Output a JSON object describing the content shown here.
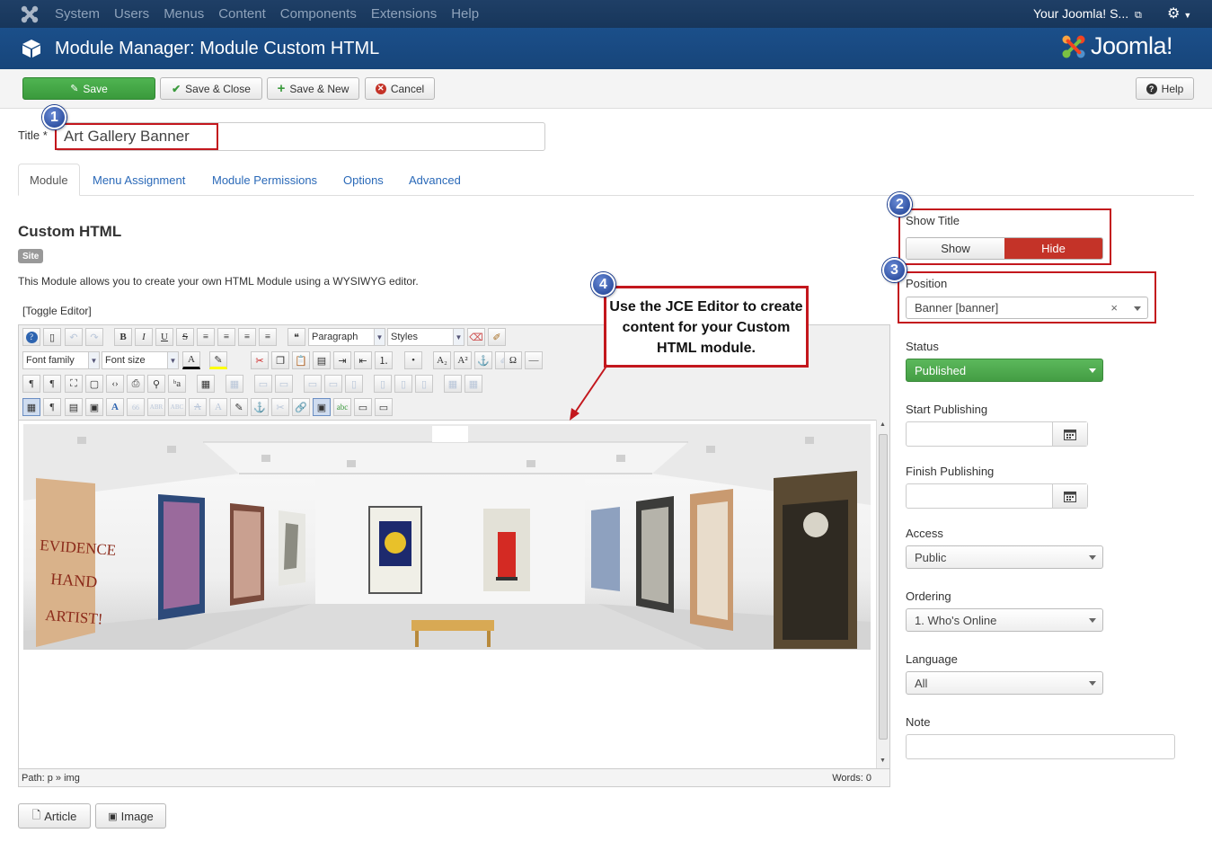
{
  "topnav": {
    "menu": [
      "System",
      "Users",
      "Menus",
      "Content",
      "Components",
      "Extensions",
      "Help"
    ],
    "site_link": "Your Joomla! S...",
    "settings_icon": "gear-icon"
  },
  "header": {
    "title": "Module Manager: Module Custom HTML",
    "logo_text": "Joomla!"
  },
  "toolbar": {
    "save": "Save",
    "save_close": "Save & Close",
    "save_new": "Save & New",
    "cancel": "Cancel",
    "help": "Help"
  },
  "form": {
    "title_label": "Title *",
    "title_value": "Art Gallery Banner"
  },
  "tabs": [
    "Module",
    "Menu Assignment",
    "Module Permissions",
    "Options",
    "Advanced"
  ],
  "module": {
    "heading": "Custom HTML",
    "badge": "Site",
    "description": "This Module allows you to create your own HTML Module using a WYSIWYG editor.",
    "toggle_editor": "[Toggle Editor]"
  },
  "editor": {
    "format_select": "Paragraph",
    "styles_select": "Styles",
    "font_family": "Font family",
    "font_size": "Font size",
    "path": "Path:  p » img",
    "words": "Words: 0",
    "gallery_text": [
      "EVIDENCE",
      "HAND",
      "ARTIST!"
    ]
  },
  "callout": {
    "number": "4",
    "text": "Use the JCE Editor to create content for your Custom HTML module."
  },
  "badges": [
    "1",
    "2",
    "3",
    "4"
  ],
  "sidebar": {
    "show_title_label": "Show Title",
    "show_option": "Show",
    "hide_option": "Hide",
    "position_label": "Position",
    "position_value": "Banner [banner]",
    "status_label": "Status",
    "status_value": "Published",
    "start_publishing_label": "Start Publishing",
    "finish_publishing_label": "Finish Publishing",
    "access_label": "Access",
    "access_value": "Public",
    "ordering_label": "Ordering",
    "ordering_value": "1. Who's Online",
    "language_label": "Language",
    "language_value": "All",
    "note_label": "Note"
  },
  "bottom_buttons": {
    "article": "Article",
    "image": "Image"
  },
  "colors": {
    "topnav": "#17365b",
    "header": "#1b4f8a",
    "save_green": "#46a546",
    "hide_red": "#c43328",
    "callout_border": "#c3171d",
    "link_blue": "#2a69b8"
  }
}
